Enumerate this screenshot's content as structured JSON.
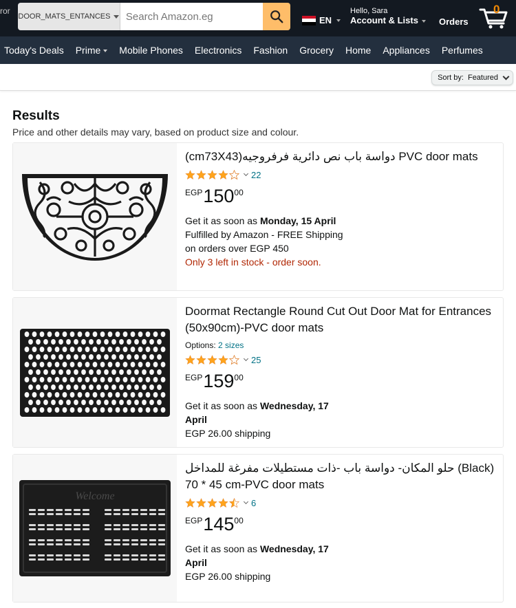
{
  "header": {
    "left_fragment": "ror",
    "department": "DOOR_MATS_ENTANCES",
    "search_placeholder": "Search Amazon.eg",
    "language": "EN",
    "hello": "Hello, Sara",
    "account_lists": "Account & Lists",
    "orders": "Orders",
    "cart_count": "0"
  },
  "nav": {
    "items": [
      "Today's Deals",
      "Prime",
      "Mobile Phones",
      "Electronics",
      "Fashion",
      "Grocery",
      "Home",
      "Appliances",
      "Perfumes"
    ]
  },
  "sort": {
    "label": "Sort by:",
    "value": "Featured"
  },
  "results": {
    "heading": "Results",
    "subtitle": "Price and other details may vary, based on product size and colour.",
    "products": [
      {
        "title": "(cm73X43)دواسة باب نص دائرية فرفروجيه PVC door mats",
        "rating": 4.0,
        "review_count": "22",
        "currency": "EGP",
        "price_whole": "150",
        "price_fraction": "00",
        "delivery_prefix": "Get it as soon as",
        "delivery_date": "Monday, 15 April",
        "fulfilled": "Fulfilled by Amazon - FREE Shipping",
        "fulfilled_line2": "on orders over EGP 450",
        "stock": "Only 3 left in stock - order soon."
      },
      {
        "title": "Doormat Rectangle Round Cut Out Door Mat for Entrances (50x90cm)-PVC door mats",
        "options_label": "Options:",
        "options_value": "2 sizes",
        "rating": 4.0,
        "review_count": "25",
        "currency": "EGP",
        "price_whole": "159",
        "price_fraction": "00",
        "delivery_prefix": "Get it as soon as",
        "delivery_date": "Wednesday, 17",
        "delivery_date_line2": "April",
        "shipping": "EGP 26.00 shipping"
      },
      {
        "title": "حلو المكان- دواسة باب -ذات مستطيلات مفرغة للمداخل (Black) 70 * 45 cm-PVC door mats",
        "rating": 4.5,
        "review_count": "6",
        "currency": "EGP",
        "price_whole": "145",
        "price_fraction": "00",
        "delivery_prefix": "Get it as soon as",
        "delivery_date": "Wednesday, 17",
        "delivery_date_line2": "April",
        "shipping": "EGP 26.00 shipping",
        "mat_text": "Welcome"
      }
    ]
  },
  "colors": {
    "header_bg": "#131921",
    "nav_bg": "#232f3e",
    "search_button": "#febd69",
    "star": "#ffa41c",
    "link": "#007185",
    "stock_red": "#b12704",
    "cart_count": "#f08804"
  },
  "icons": [
    "search-icon",
    "egypt-flag-icon",
    "cart-icon",
    "star-icon",
    "chevron-down-icon"
  ]
}
